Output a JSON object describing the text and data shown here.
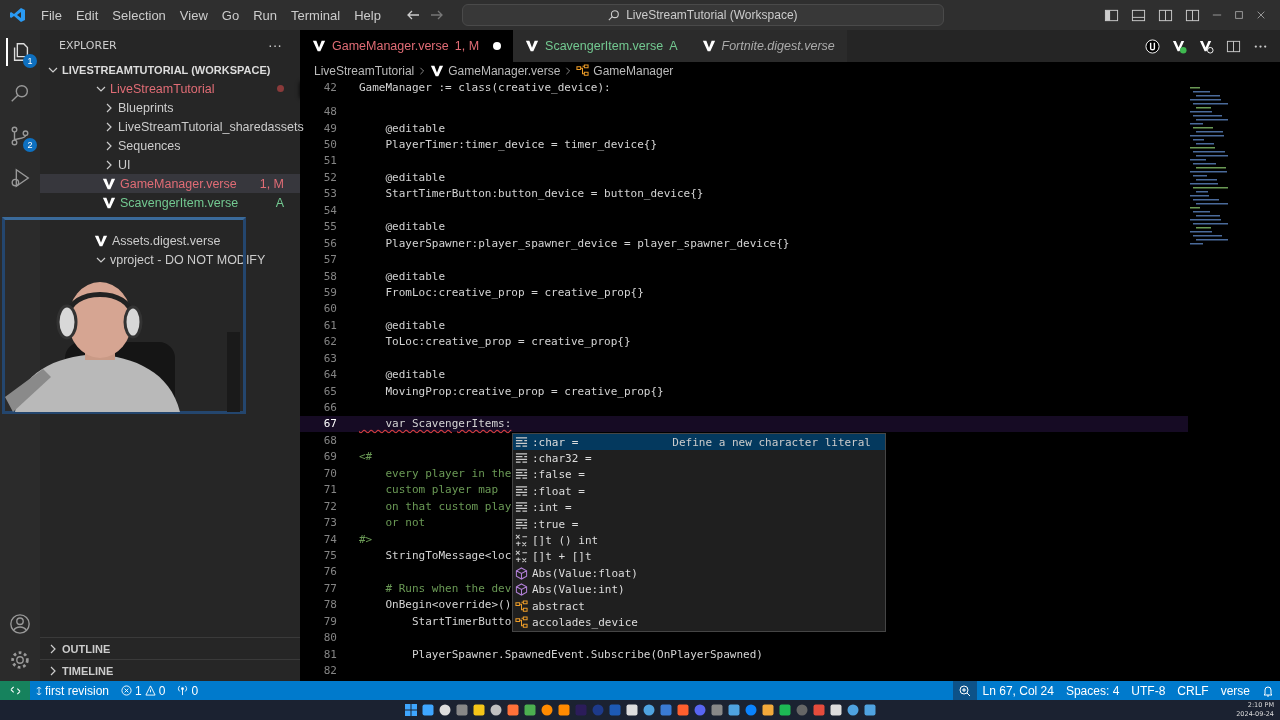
{
  "menu": [
    "File",
    "Edit",
    "Selection",
    "View",
    "Go",
    "Run",
    "Terminal",
    "Help"
  ],
  "command_center": "LiveStreamTutorial (Workspace)",
  "activity_bar": [
    {
      "kind": "explorer",
      "badge": "1",
      "selected": true
    },
    {
      "kind": "search",
      "selected": false
    },
    {
      "kind": "source-control",
      "badge": "2",
      "selected": false
    },
    {
      "kind": "run",
      "selected": false
    }
  ],
  "explorer": {
    "title": "EXPLORER",
    "more": "···",
    "workspace": "LIVESTREAMTUTORIAL (WORKSPACE)",
    "tree": [
      {
        "label": "LiveStreamTutorial",
        "kind": "folder",
        "expanded": true,
        "changes": true,
        "color": "#e06c75",
        "selected": false,
        "children": [
          {
            "label": "Blueprints",
            "kind": "folder",
            "expanded": false,
            "changes": false,
            "selected": false
          },
          {
            "label": "LiveStreamTutorial_sharedassets",
            "kind": "folder",
            "expanded": false,
            "changes": false,
            "selected": false
          },
          {
            "label": "Sequences",
            "kind": "folder",
            "expanded": false,
            "changes": false,
            "selected": false
          },
          {
            "label": "UI",
            "kind": "folder",
            "expanded": false,
            "changes": false,
            "selected": false
          },
          {
            "label": "GameManager.verse",
            "kind": "verse",
            "status": "1, M",
            "color": "#e06c75",
            "selected": true
          },
          {
            "label": "ScavengerItem.verse",
            "kind": "verse",
            "status": "A",
            "color": "#73c991",
            "selected": false
          }
        ]
      },
      {
        "kind": "hidden"
      },
      {
        "label": "Assets.digest.verse",
        "kind": "verse",
        "selected": false
      },
      {
        "label": "vproject - DO NOT MODIFY",
        "kind": "folder",
        "expanded": true,
        "changes": false,
        "selected": false
      }
    ],
    "sections": [
      {
        "label": "OUTLINE",
        "expanded": false
      },
      {
        "label": "TIMELINE",
        "expanded": false
      }
    ]
  },
  "tabs": [
    {
      "label": "GameManager.verse",
      "status": "1, M",
      "color": "#e06c75",
      "selected": true,
      "dirty": true,
      "preview": false
    },
    {
      "label": "ScavengerItem.verse",
      "status": "A",
      "color": "#73c991",
      "selected": false,
      "dirty": false,
      "preview": false
    },
    {
      "label": "Fortnite.digest.verse",
      "selected": false,
      "dirty": false,
      "preview": true
    }
  ],
  "breadcrumbs": [
    {
      "label": "LiveStreamTutorial",
      "kind": "folder"
    },
    {
      "label": "GameManager.verse",
      "kind": "verse"
    },
    {
      "label": "GameManager",
      "kind": "class"
    }
  ],
  "sticky_line": {
    "number": "42",
    "text": "GameManager := class(creative_device):"
  },
  "lines": [
    {
      "number": "48",
      "kind": "code"
    },
    {
      "number": "49",
      "text": "    @editable",
      "kind": "code"
    },
    {
      "number": "50",
      "text": "    PlayerTimer:timer_device = timer_device{}",
      "kind": "code"
    },
    {
      "number": "51",
      "kind": "code"
    },
    {
      "number": "52",
      "text": "    @editable",
      "kind": "code"
    },
    {
      "number": "53",
      "text": "    StartTimerButton:button_device = button_device{}",
      "kind": "code"
    },
    {
      "number": "54",
      "kind": "code"
    },
    {
      "number": "55",
      "text": "    @editable",
      "kind": "code"
    },
    {
      "number": "56",
      "text": "    PlayerSpawner:player_spawner_device = player_spawner_device{}",
      "kind": "code"
    },
    {
      "number": "57",
      "kind": "code"
    },
    {
      "number": "58",
      "text": "    @editable",
      "kind": "code"
    },
    {
      "number": "59",
      "text": "    FromLoc:creative_prop = creative_prop{}",
      "kind": "code"
    },
    {
      "number": "60",
      "kind": "code"
    },
    {
      "number": "61",
      "text": "    @editable",
      "kind": "code"
    },
    {
      "number": "62",
      "text": "    ToLoc:creative_prop = creative_prop{}",
      "kind": "code"
    },
    {
      "number": "63",
      "kind": "code"
    },
    {
      "number": "64",
      "text": "    @editable",
      "kind": "code"
    },
    {
      "number": "65",
      "text": "    MovingProp:creative_prop = creative_prop{}",
      "kind": "code"
    },
    {
      "number": "66",
      "kind": "code"
    },
    {
      "number": "67",
      "text": "    var ScavengerItems:",
      "kind": "active"
    },
    {
      "number": "68",
      "kind": "code"
    },
    {
      "number": "69",
      "text": "<#",
      "kind": "comment"
    },
    {
      "number": "70",
      "text": "    every player in the",
      "kind": "comment"
    },
    {
      "number": "71",
      "text": "    custom player map",
      "kind": "comment"
    },
    {
      "number": "72",
      "text": "    on that custom play",
      "kind": "comment"
    },
    {
      "number": "73",
      "text": "    or not",
      "kind": "comment"
    },
    {
      "number": "74",
      "text": "#>",
      "kind": "comment"
    },
    {
      "number": "75",
      "text": "    StringToMessage<loc",
      "kind": "code"
    },
    {
      "number": "76",
      "kind": "code"
    },
    {
      "number": "77",
      "text": "    # Runs when the dev",
      "kind": "comment"
    },
    {
      "number": "78",
      "text": "    OnBegin<override>()",
      "kind": "code"
    },
    {
      "number": "79",
      "text": "        StartTimerButto",
      "kind": "code"
    },
    {
      "number": "80",
      "kind": "code"
    },
    {
      "number": "81",
      "text": "        PlayerSpawner.SpawnedEvent.Subscribe(OnPlayerSpawned)",
      "kind": "code"
    },
    {
      "number": "82",
      "kind": "code"
    }
  ],
  "suggestions": [
    {
      "label": ":char =",
      "kind": "snippet",
      "selected": true,
      "detail": "Define a new character literal"
    },
    {
      "label": ":char32 =",
      "kind": "snippet",
      "selected": false
    },
    {
      "label": ":false =",
      "kind": "snippet",
      "selected": false
    },
    {
      "label": ":float =",
      "kind": "snippet",
      "selected": false
    },
    {
      "label": ":int =",
      "kind": "snippet",
      "selected": false
    },
    {
      "label": ":true =",
      "kind": "snippet",
      "selected": false
    },
    {
      "label": "[]t () int",
      "kind": "operator",
      "selected": false
    },
    {
      "label": "[]t + []t",
      "kind": "operator",
      "selected": false
    },
    {
      "label": "Abs(Value:float)",
      "kind": "function",
      "selected": false
    },
    {
      "label": "Abs(Value:int)",
      "kind": "function",
      "selected": false
    },
    {
      "label": "abstract",
      "kind": "class",
      "selected": false
    },
    {
      "label": "accolades_device",
      "kind": "class",
      "selected": false
    }
  ],
  "status_bar": {
    "branch": "first revision",
    "errors": "1",
    "warnings": "0",
    "ports": "0",
    "position": "Ln 67, Col 24",
    "indent": "Spaces: 4",
    "encoding": "UTF-8",
    "eol": "CRLF",
    "language": "verse"
  },
  "clock": {
    "time": "2:10 PM",
    "date": "2024-09-24"
  }
}
